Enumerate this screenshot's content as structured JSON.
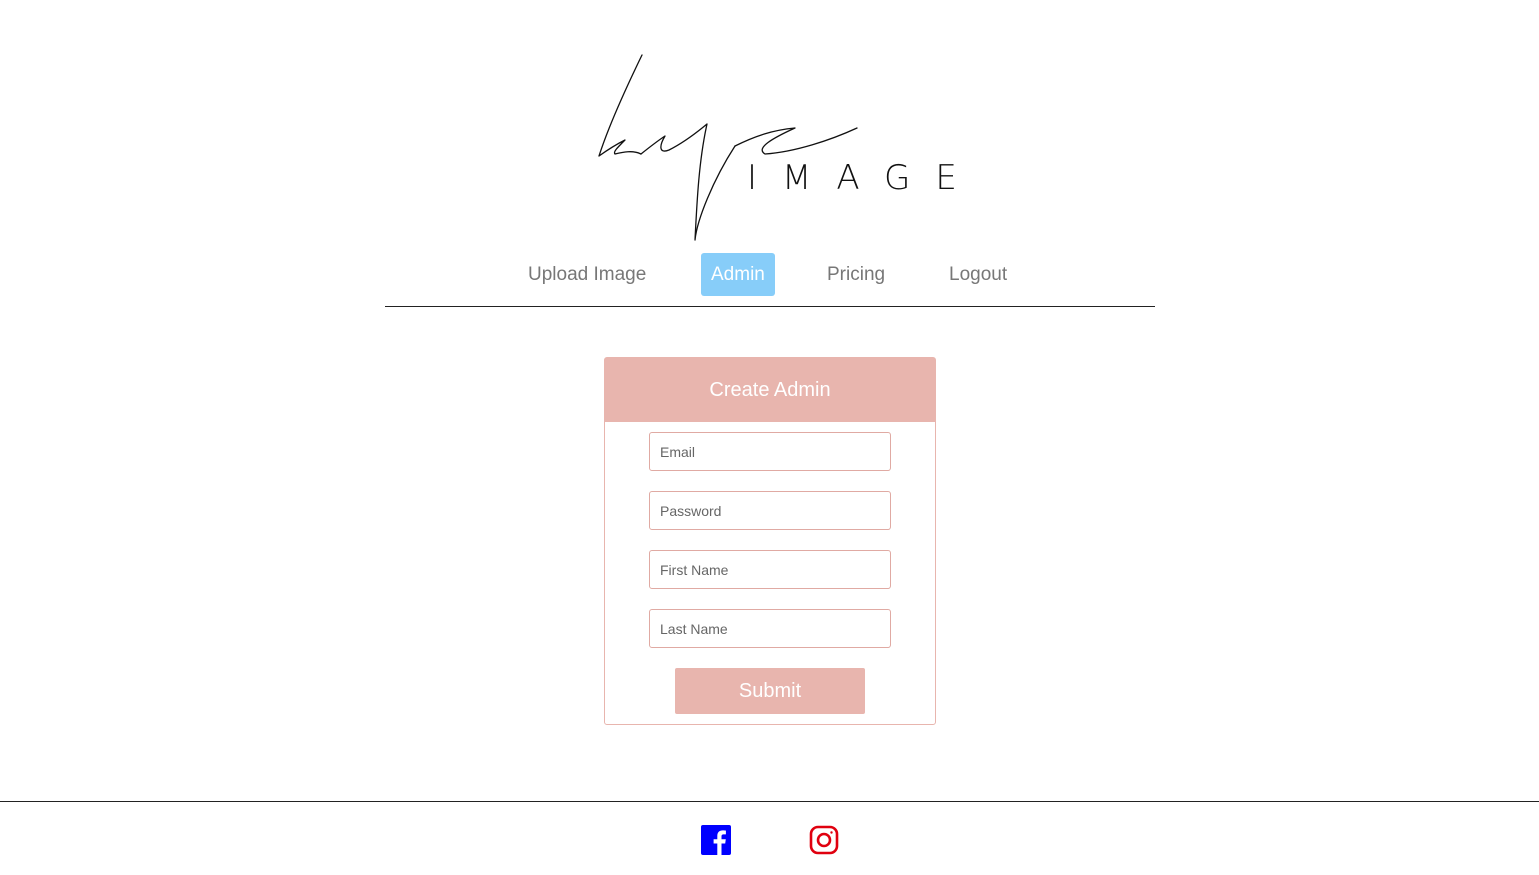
{
  "logo": {
    "script_text": "kye",
    "word_text": "IMAGE"
  },
  "nav": {
    "items": [
      {
        "label": "Upload Image",
        "active": false
      },
      {
        "label": "Admin",
        "active": true
      },
      {
        "label": "Pricing",
        "active": false
      },
      {
        "label": "Logout",
        "active": false
      }
    ]
  },
  "form": {
    "title": "Create Admin",
    "fields": [
      {
        "placeholder": "Email",
        "value": ""
      },
      {
        "placeholder": "Password",
        "value": ""
      },
      {
        "placeholder": "First Name",
        "value": ""
      },
      {
        "placeholder": "Last Name",
        "value": ""
      }
    ],
    "submit_label": "Submit"
  },
  "footer": {
    "icons": [
      {
        "name": "facebook-icon",
        "color": "#0000ff"
      },
      {
        "name": "instagram-icon",
        "color": "#e0000f"
      }
    ]
  },
  "colors": {
    "accent": "#e8b5ae",
    "active_nav": "#87CDF9"
  }
}
